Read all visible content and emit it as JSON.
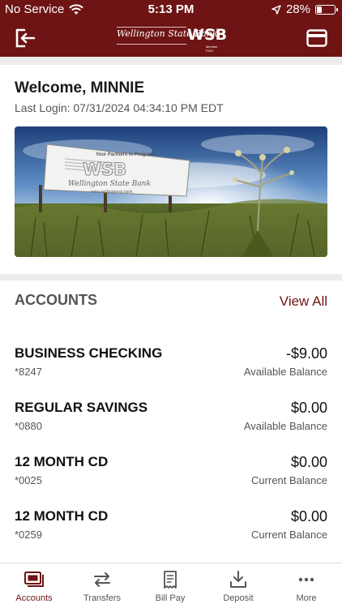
{
  "status_bar": {
    "carrier": "No Service",
    "time": "5:13 PM",
    "battery": "28%",
    "battery_level": 0.28
  },
  "header": {
    "logo_script": "Wellington State Bank",
    "logo_mark": "WSB",
    "logo_fdic": "Member FDIC"
  },
  "welcome": {
    "title": "Welcome, MINNIE",
    "last_login": "Last Login: 07/31/2024 04:34:10 PM EDT"
  },
  "banner": {
    "tagline": "Your Partners in Progress",
    "sign_mark": "WSB",
    "sign_name": "Wellington State Bank",
    "sign_url": "www.wellingtonsb.bank"
  },
  "accounts": {
    "title": "ACCOUNTS",
    "view_all": "View All",
    "items": [
      {
        "name": "BUSINESS CHECKING",
        "number": "*8247",
        "balance": "-$9.00",
        "balance_label": "Available Balance"
      },
      {
        "name": "REGULAR SAVINGS",
        "number": "*0880",
        "balance": "$0.00",
        "balance_label": "Available Balance"
      },
      {
        "name": "12 MONTH CD",
        "number": "*0025",
        "balance": "$0.00",
        "balance_label": "Current Balance"
      },
      {
        "name": "12 MONTH CD",
        "number": "*0259",
        "balance": "$0.00",
        "balance_label": "Current Balance"
      }
    ]
  },
  "tabs": [
    {
      "label": "Accounts",
      "icon": "accounts-icon",
      "active": true
    },
    {
      "label": "Transfers",
      "icon": "transfers-icon",
      "active": false
    },
    {
      "label": "Bill Pay",
      "icon": "bill-pay-icon",
      "active": false
    },
    {
      "label": "Deposit",
      "icon": "deposit-icon",
      "active": false
    },
    {
      "label": "More",
      "icon": "more-icon",
      "active": false
    }
  ],
  "colors": {
    "brand": "#6e1414",
    "background": "#ececec"
  }
}
